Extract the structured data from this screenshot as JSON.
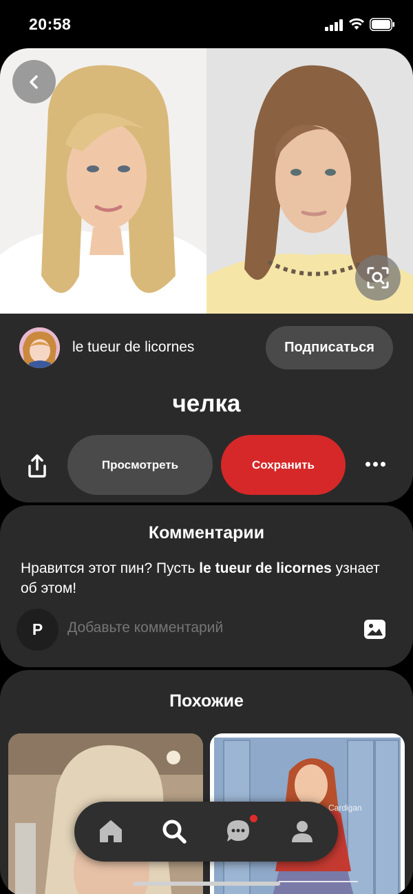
{
  "status_bar": {
    "time": "20:58"
  },
  "pin": {
    "images": [
      "blonde-woman-with-bangs",
      "brunette-woman-with-bangs"
    ],
    "author": {
      "name": "le tueur de licornes"
    },
    "follow_label": "Подписаться",
    "title": "челка",
    "view_label": "Просмотреть",
    "save_label": "Сохранить"
  },
  "comments": {
    "title": "Комментарии",
    "prompt_prefix": "Нравится этот пин? Пусть ",
    "prompt_author": "le tueur de licornes",
    "prompt_suffix": " узнает об этом!",
    "user_initial": "P",
    "placeholder": "Добавьте комментарий"
  },
  "similar": {
    "title": "Похожие",
    "items": [
      "blonde-bangs-thumbnail",
      "girl-in-school-hallway-thumbnail"
    ],
    "overlay_text": "Cardigan"
  },
  "nav": {
    "items": [
      "home-icon",
      "search-icon",
      "messages-icon",
      "profile-icon"
    ],
    "messages_has_notification": true
  },
  "colors": {
    "background": "#000000",
    "card": "#2a2a2a",
    "button_secondary": "#4a4a4a",
    "accent_red": "#d62828",
    "notification": "#e02c2c"
  }
}
